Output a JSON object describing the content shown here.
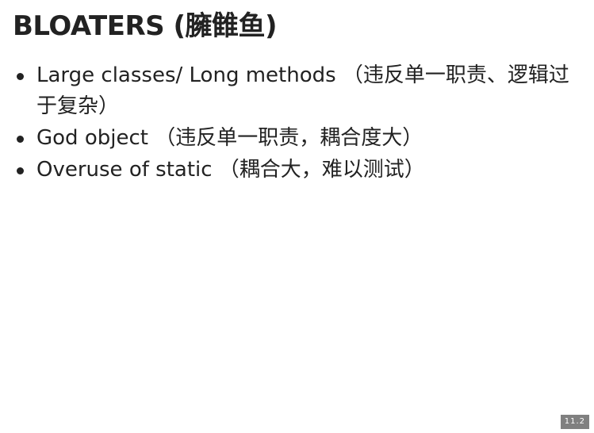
{
  "slide": {
    "title": "BLOATERS (臃雔鱼)",
    "bullets": [
      "Large classes/ Long methods （违反单一职责、逻辑过于复杂）",
      "God object （违反单一职责，耦合度大）",
      "Overuse of static （耦合大，难以测试）"
    ],
    "slide_number": "11.2"
  }
}
